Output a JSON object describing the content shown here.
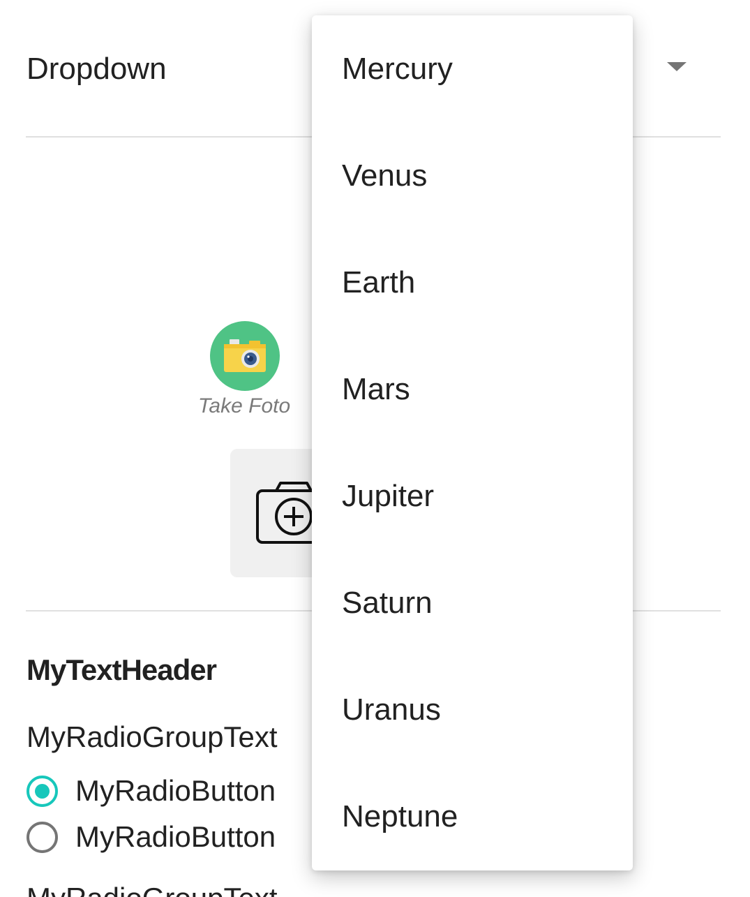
{
  "dropdown": {
    "label": "Dropdown",
    "arrow_icon": "arrow-drop-down-icon",
    "options": [
      "Mercury",
      "Venus",
      "Earth",
      "Mars",
      "Jupiter",
      "Saturn",
      "Uranus",
      "Neptune"
    ]
  },
  "photo": {
    "icon": "camera-icon",
    "caption": "Take Foto",
    "add_icon": "add-photo-camera-icon"
  },
  "form": {
    "header": "MyTextHeader",
    "radio_groups": [
      {
        "text": "MyRadioGroupText",
        "buttons": [
          {
            "label": "MyRadioButton",
            "checked": true
          },
          {
            "label": "MyRadioButton",
            "checked": false
          }
        ]
      },
      {
        "text": "MyRadioGroupText"
      }
    ]
  },
  "colors": {
    "accent": "#17c7bb",
    "camera_badge": "#4fc385",
    "divider": "#e0e0e0"
  }
}
